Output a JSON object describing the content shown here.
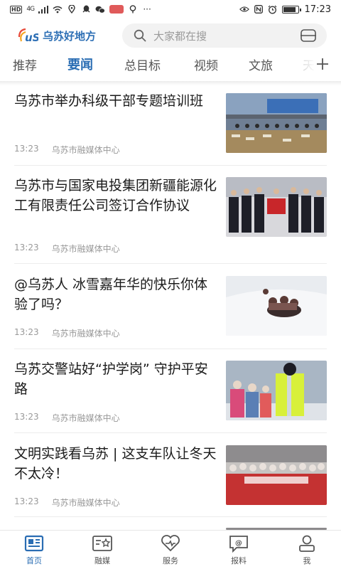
{
  "status_bar": {
    "time": "17:23",
    "network": "4G",
    "hd_badge": "HD",
    "battery_percent": 85
  },
  "header": {
    "logo_text": "乌苏好地方",
    "search_placeholder": "大家都在搜"
  },
  "tabs": [
    {
      "label": "推荐",
      "active": false
    },
    {
      "label": "要闻",
      "active": true
    },
    {
      "label": "总目标",
      "active": false
    },
    {
      "label": "视频",
      "active": false
    },
    {
      "label": "文旅",
      "active": false
    },
    {
      "label": "天",
      "active": false
    }
  ],
  "news": [
    {
      "title": "乌苏市举办科级干部专题培训班",
      "time": "13:23",
      "source": "乌苏市融媒体中心"
    },
    {
      "title": "乌苏市与国家电投集团新疆能源化工有限责任公司签订合作协议",
      "time": "13:23",
      "source": "乌苏市融媒体中心"
    },
    {
      "title": "@乌苏人 冰雪嘉年华的快乐你体验了吗？",
      "time": "13:23",
      "source": "乌苏市融媒体中心"
    },
    {
      "title": "乌苏交警站好“护学岗” 守护平安路",
      "time": "13:23",
      "source": "乌苏市融媒体中心"
    },
    {
      "title": "文明实践看乌苏 | 这支车队让冬天不太冷！",
      "time": "13:23",
      "source": "乌苏市融媒体中心"
    }
  ],
  "bottom_nav": [
    {
      "label": "首页",
      "icon": "home-news-icon",
      "active": true
    },
    {
      "label": "融媒",
      "icon": "media-card-icon",
      "active": false
    },
    {
      "label": "服务",
      "icon": "heart-service-icon",
      "active": false
    },
    {
      "label": "报料",
      "icon": "report-chat-icon",
      "active": false
    },
    {
      "label": "我",
      "icon": "profile-icon",
      "active": false
    }
  ],
  "colors": {
    "accent": "#2a6db3",
    "text": "#1a1a1a",
    "meta": "#999999"
  }
}
